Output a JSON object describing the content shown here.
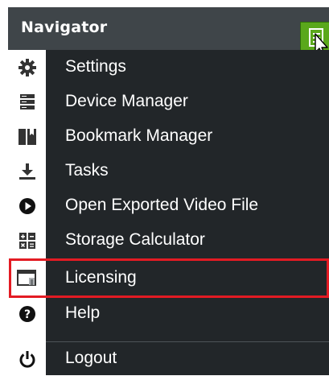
{
  "header": {
    "title": "Navigator"
  },
  "menu": {
    "items": [
      {
        "label": "Settings",
        "icon": "gear-icon"
      },
      {
        "label": "Device Manager",
        "icon": "server-icon"
      },
      {
        "label": "Bookmark Manager",
        "icon": "bookmark-icon"
      },
      {
        "label": "Tasks",
        "icon": "download-icon"
      },
      {
        "label": "Open Exported Video File",
        "icon": "play-icon"
      },
      {
        "label": "Storage Calculator",
        "icon": "calculator-icon"
      },
      {
        "label": "Licensing",
        "icon": "license-icon"
      },
      {
        "label": "Help",
        "icon": "help-icon"
      },
      {
        "label": "Logout",
        "icon": "power-icon"
      }
    ],
    "highlighted": "Licensing"
  },
  "colors": {
    "header_bg": "#3f4549",
    "menu_bg": "#222629",
    "menu_button": "#5aa81b",
    "highlight_border": "#e31b23"
  }
}
